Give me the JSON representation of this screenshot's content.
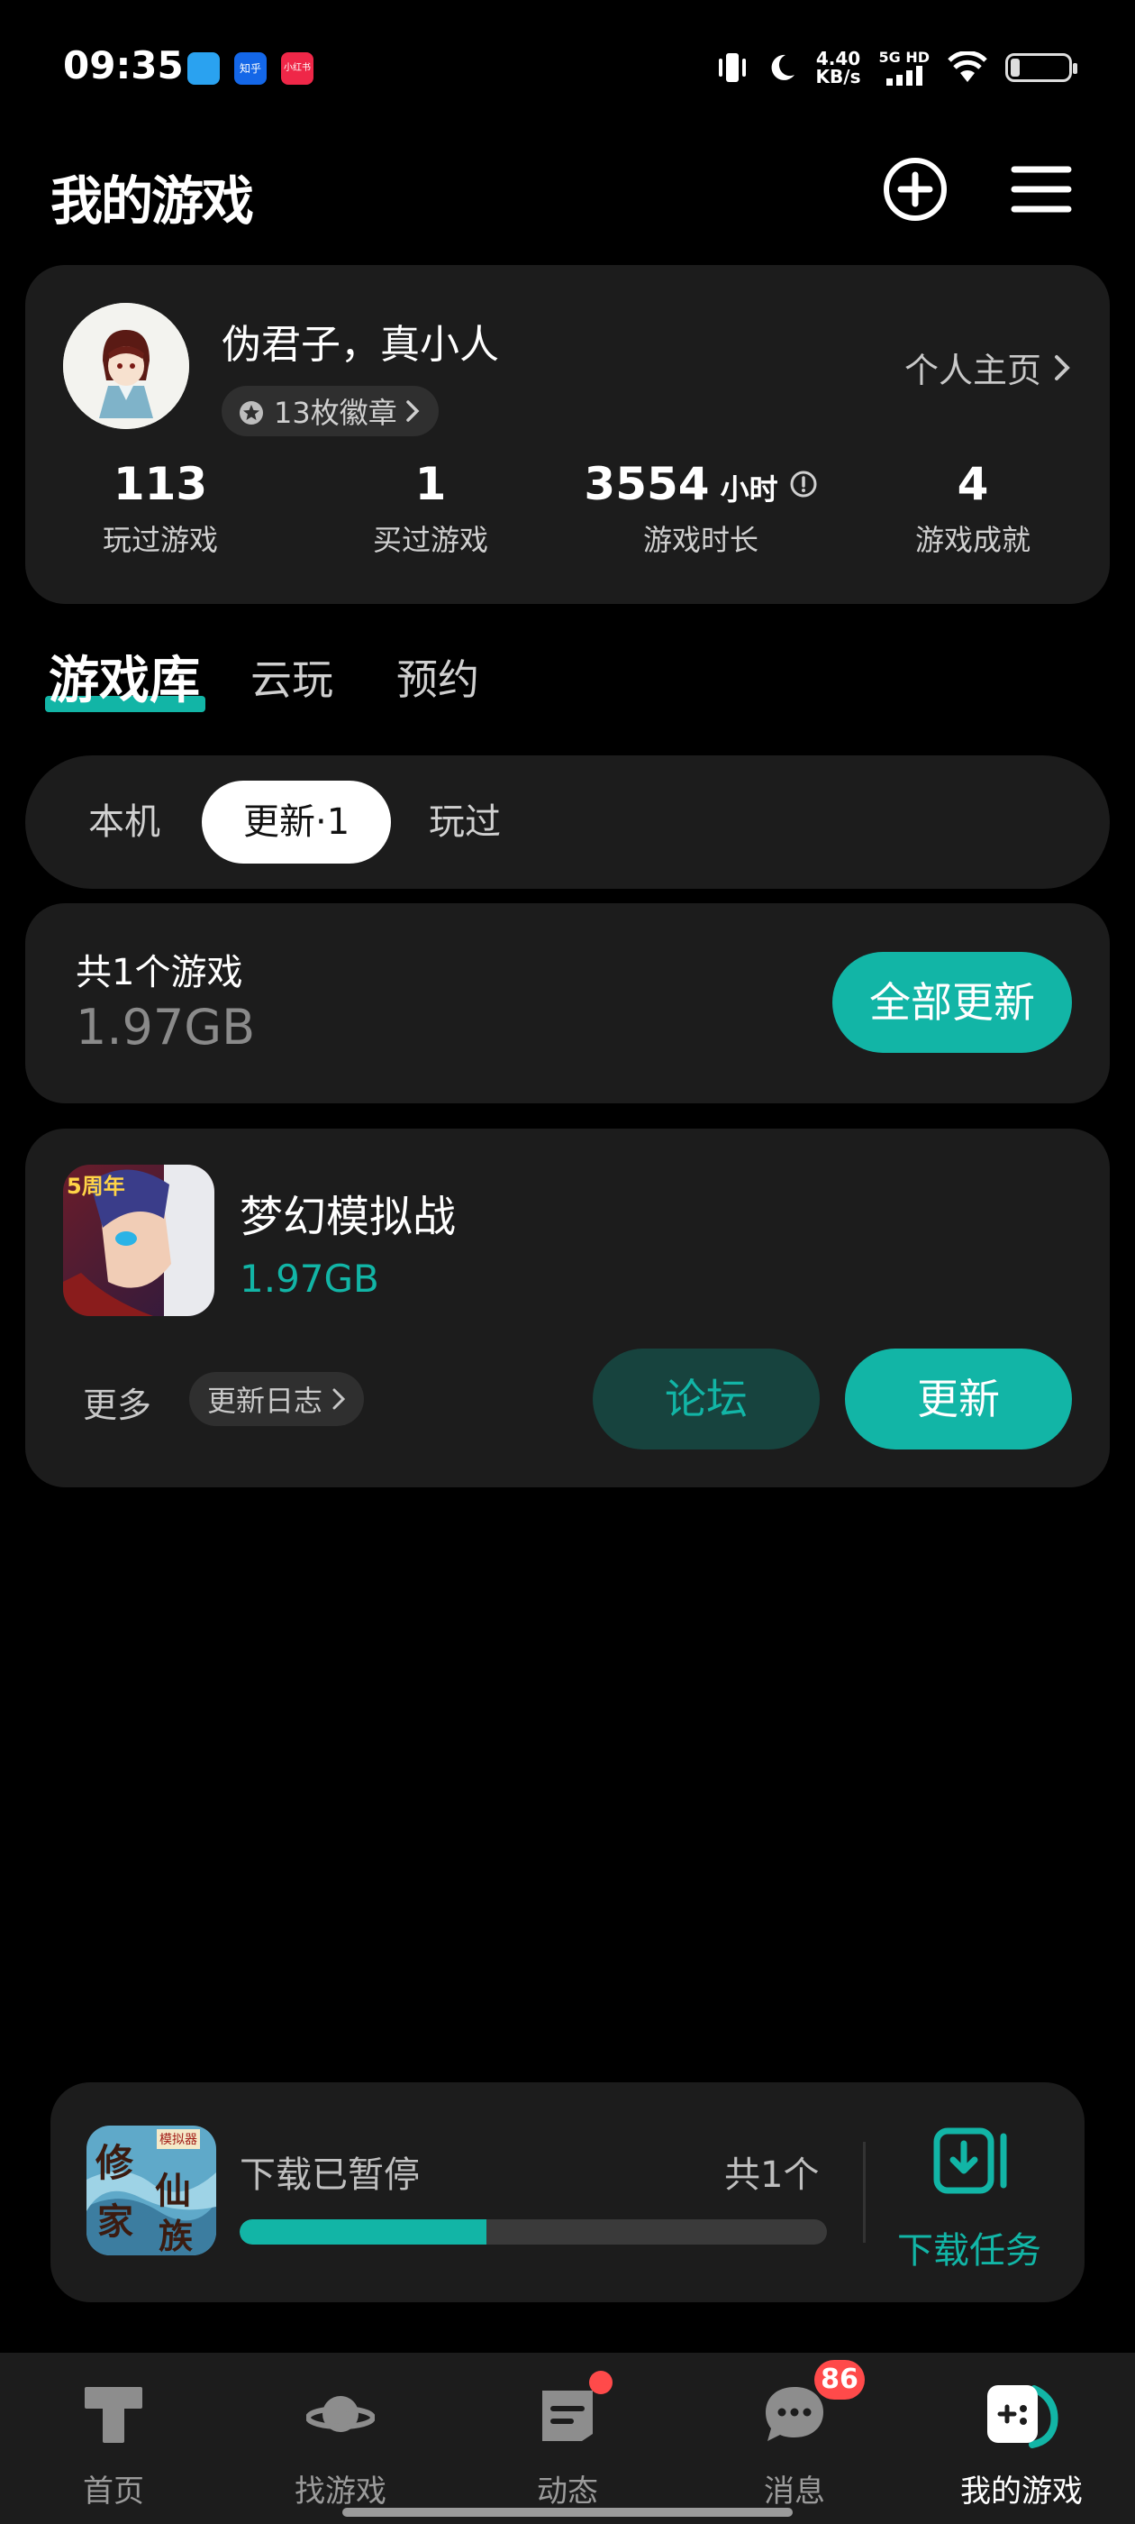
{
  "status_bar": {
    "time": "09:35",
    "notif_icons": [
      "doc-app-icon",
      "zhihu-icon",
      "xiaohongshu-icon"
    ],
    "notif_labels": [
      "",
      "知乎",
      "小红书"
    ],
    "net_speed_value": "4.40",
    "net_speed_unit": "KB/s",
    "signal": "5G HD",
    "battery": "4"
  },
  "header": {
    "title": "我的游戏",
    "icons": [
      "add-circle-icon",
      "menu-icon"
    ]
  },
  "profile": {
    "username": "伪君子，真小人",
    "badge_label": "13枚徽章",
    "homepage_link": "个人主页",
    "stats": [
      {
        "value": "113",
        "unit": "",
        "label": "玩过游戏"
      },
      {
        "value": "1",
        "unit": "",
        "label": "买过游戏"
      },
      {
        "value": "3554",
        "unit": "小时",
        "label": "游戏时长"
      },
      {
        "value": "4",
        "unit": "",
        "label": "游戏成就"
      }
    ]
  },
  "main_tabs": [
    "游戏库",
    "云玩",
    "预约"
  ],
  "main_tab_active": "游戏库",
  "filters": [
    "本机",
    "更新·1",
    "玩过"
  ],
  "filter_active": "更新·1",
  "summary": {
    "title": "共1个游戏",
    "size": "1.97GB",
    "button": "全部更新"
  },
  "game": {
    "name": "梦幻模拟战",
    "size": "1.97GB",
    "icon_text": "5周年",
    "more": "更多",
    "log": "更新日志",
    "forum": "论坛",
    "update": "更新"
  },
  "download": {
    "icon_text": [
      "修",
      "仙",
      "家",
      "族"
    ],
    "icon_tag": "模拟器",
    "status": "下载已暂停",
    "count": "共1个",
    "progress": 0.42,
    "task_label": "下载任务"
  },
  "nav": {
    "items": [
      {
        "label": "首页",
        "icon": "home-icon"
      },
      {
        "label": "找游戏",
        "icon": "planet-icon"
      },
      {
        "label": "动态",
        "icon": "feed-icon"
      },
      {
        "label": "消息",
        "icon": "message-icon",
        "badge": "86"
      },
      {
        "label": "我的游戏",
        "icon": "gamepad-icon"
      }
    ],
    "active": "我的游戏"
  },
  "colors": {
    "accent": "#12b5a6",
    "card": "#1c1c1c",
    "badge_red": "#ff4a4a"
  }
}
